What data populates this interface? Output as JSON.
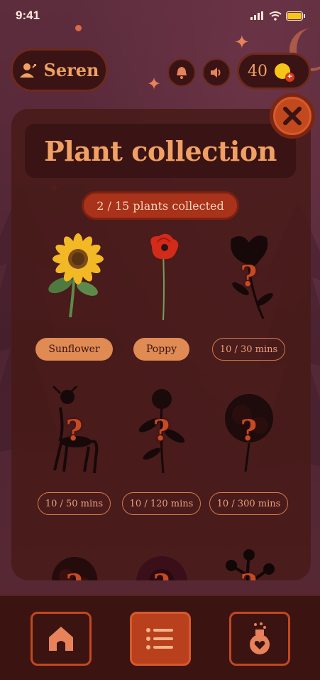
{
  "status": {
    "time": "9:41"
  },
  "header": {
    "username": "Seren",
    "coins": "40"
  },
  "colors": {
    "accent": "#f0a064",
    "dark": "#3a1414",
    "button": "#c2481e"
  },
  "panel": {
    "title": "Plant collection",
    "collected_text": "2 / 15 plants collected"
  },
  "plants": [
    {
      "label": "Sunflower",
      "unlocked": true,
      "icon": "sunflower-icon"
    },
    {
      "label": "Poppy",
      "unlocked": true,
      "icon": "poppy-icon"
    },
    {
      "label": "10 / 30 mins",
      "unlocked": false,
      "icon": "locked-lily-icon"
    },
    {
      "label": "10 / 50 mins",
      "unlocked": false,
      "icon": "locked-deer-icon"
    },
    {
      "label": "10 / 120 mins",
      "unlocked": false,
      "icon": "locked-rose-icon"
    },
    {
      "label": "10 / 300 mins",
      "unlocked": false,
      "icon": "locked-bouquet-icon"
    },
    {
      "label": "",
      "unlocked": false,
      "icon": "locked-flower-icon"
    },
    {
      "label": "",
      "unlocked": false,
      "icon": "locked-bloom-icon"
    },
    {
      "label": "",
      "unlocked": false,
      "icon": "locked-branch-icon"
    }
  ],
  "question_mark": "?",
  "nav": {
    "items": [
      {
        "name": "home",
        "icon": "home-icon",
        "active": false
      },
      {
        "name": "list",
        "icon": "list-icon",
        "active": true
      },
      {
        "name": "potion",
        "icon": "potion-icon",
        "active": false
      }
    ]
  }
}
